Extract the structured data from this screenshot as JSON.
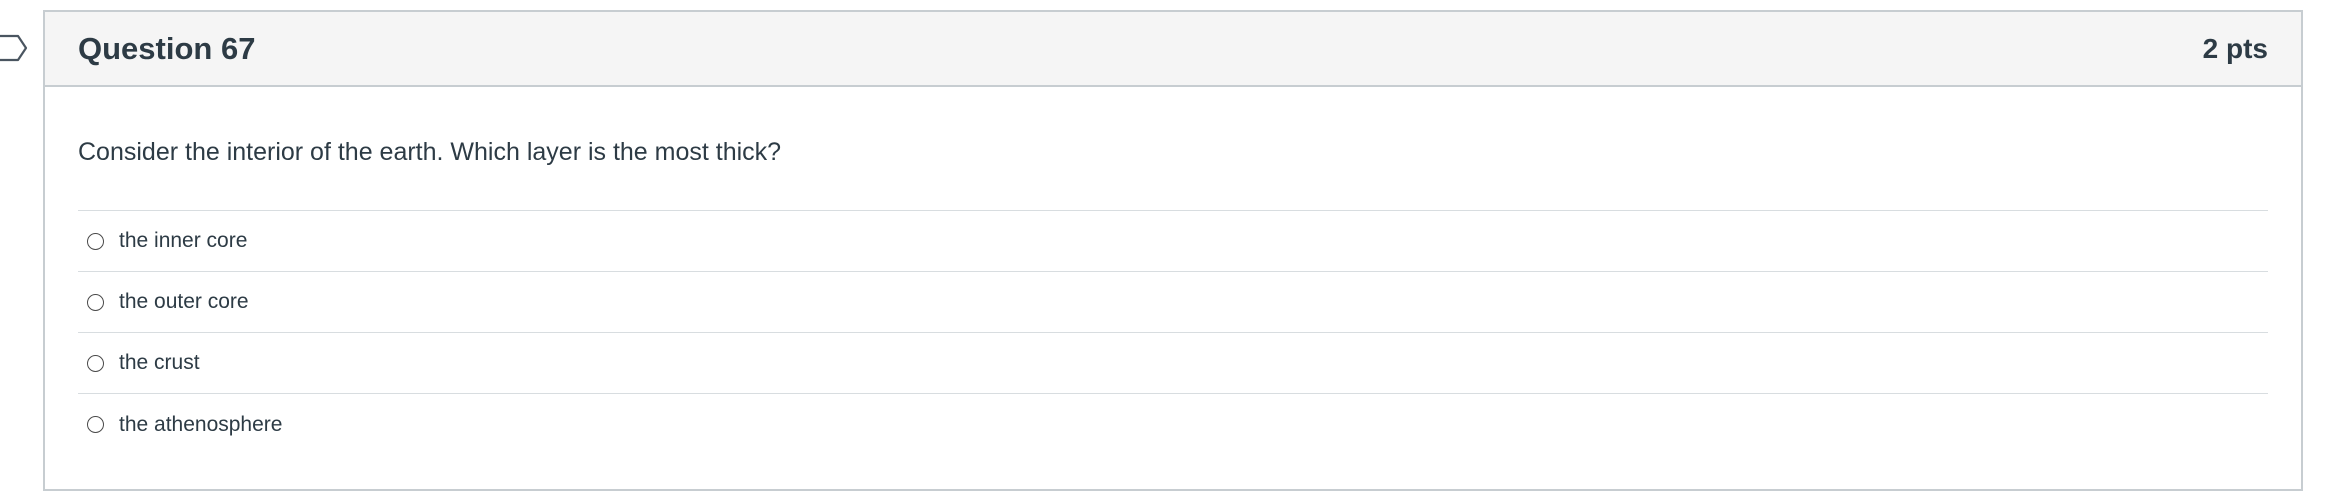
{
  "question": {
    "title": "Question 67",
    "points": "2 pts",
    "text": "Consider the interior of the earth. Which layer is the most thick?",
    "answers": [
      {
        "label": "the inner core",
        "selected": false
      },
      {
        "label": "the outer core",
        "selected": false
      },
      {
        "label": "the crust",
        "selected": false
      },
      {
        "label": "the athenosphere",
        "selected": false
      }
    ]
  },
  "icons": {
    "flag": "bookmark-flag-icon",
    "radio": "radio-unselected"
  },
  "colors": {
    "text": "#2d3b45",
    "header_bg": "#f5f5f5",
    "border": "#c7cdd1",
    "divider": "#d8dde0"
  }
}
